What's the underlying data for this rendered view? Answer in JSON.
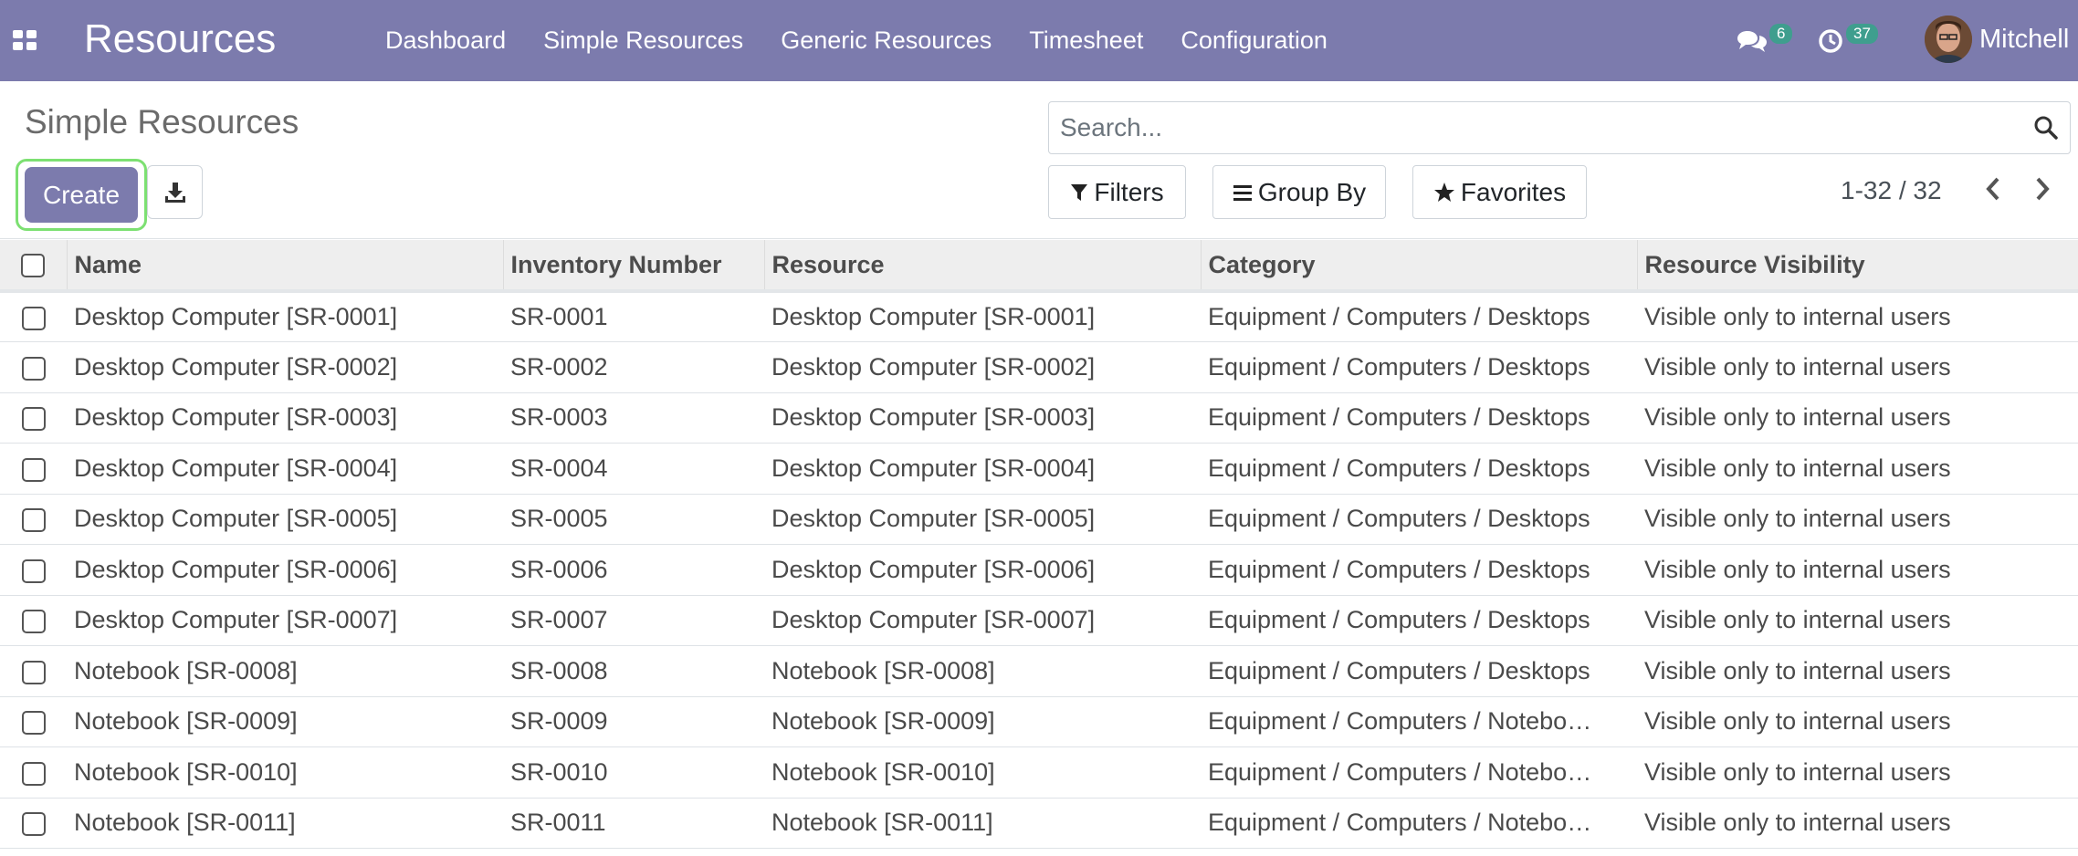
{
  "navbar": {
    "app_title": "Resources",
    "menu": [
      "Dashboard",
      "Simple Resources",
      "Generic Resources",
      "Timesheet",
      "Configuration"
    ],
    "messages_count": "6",
    "activities_count": "37",
    "user_name": "Mitchell",
    "accent_color": "#7c7bad",
    "badge_color": "#3f9e8e"
  },
  "control_panel": {
    "title": "Simple Resources",
    "create_label": "Create",
    "search_placeholder": "Search...",
    "filters_label": "Filters",
    "groupby_label": "Group By",
    "favorites_label": "Favorites",
    "pager_text": "1-32 / 32"
  },
  "table": {
    "columns": [
      "Name",
      "Inventory Number",
      "Resource",
      "Category",
      "Resource Visibility"
    ],
    "rows": [
      [
        "Desktop Computer [SR-0001]",
        "SR-0001",
        "Desktop Computer [SR-0001]",
        "Equipment / Computers / Desktops",
        "Visible only to internal users"
      ],
      [
        "Desktop Computer [SR-0002]",
        "SR-0002",
        "Desktop Computer [SR-0002]",
        "Equipment / Computers / Desktops",
        "Visible only to internal users"
      ],
      [
        "Desktop Computer [SR-0003]",
        "SR-0003",
        "Desktop Computer [SR-0003]",
        "Equipment / Computers / Desktops",
        "Visible only to internal users"
      ],
      [
        "Desktop Computer [SR-0004]",
        "SR-0004",
        "Desktop Computer [SR-0004]",
        "Equipment / Computers / Desktops",
        "Visible only to internal users"
      ],
      [
        "Desktop Computer [SR-0005]",
        "SR-0005",
        "Desktop Computer [SR-0005]",
        "Equipment / Computers / Desktops",
        "Visible only to internal users"
      ],
      [
        "Desktop Computer [SR-0006]",
        "SR-0006",
        "Desktop Computer [SR-0006]",
        "Equipment / Computers / Desktops",
        "Visible only to internal users"
      ],
      [
        "Desktop Computer [SR-0007]",
        "SR-0007",
        "Desktop Computer [SR-0007]",
        "Equipment / Computers / Desktops",
        "Visible only to internal users"
      ],
      [
        "Notebook [SR-0008]",
        "SR-0008",
        "Notebook [SR-0008]",
        "Equipment / Computers / Desktops",
        "Visible only to internal users"
      ],
      [
        "Notebook [SR-0009]",
        "SR-0009",
        "Notebook [SR-0009]",
        "Equipment / Computers / Notebo…",
        "Visible only to internal users"
      ],
      [
        "Notebook [SR-0010]",
        "SR-0010",
        "Notebook [SR-0010]",
        "Equipment / Computers / Notebo…",
        "Visible only to internal users"
      ],
      [
        "Notebook [SR-0011]",
        "SR-0011",
        "Notebook [SR-0011]",
        "Equipment / Computers / Notebo…",
        "Visible only to internal users"
      ]
    ]
  }
}
